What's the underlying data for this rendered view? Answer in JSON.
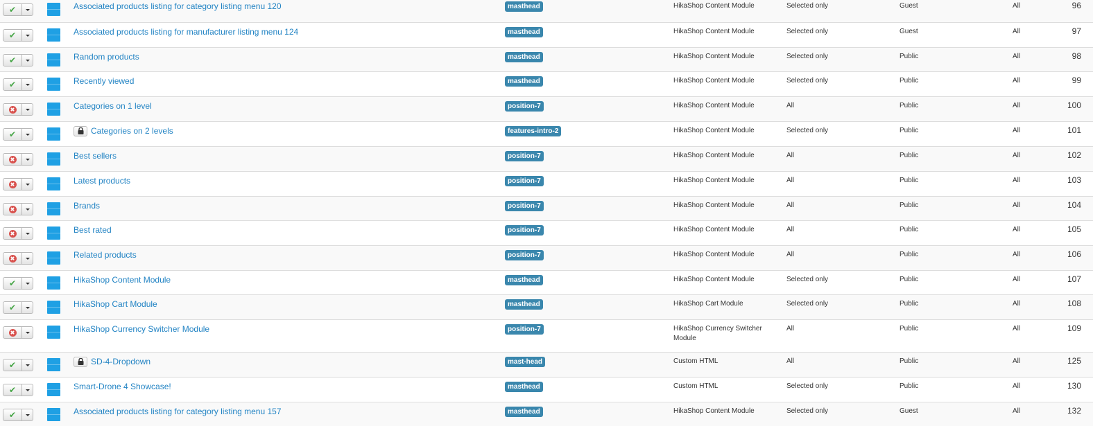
{
  "icons": {
    "published": "check-icon",
    "unpublished": "x-circle-icon",
    "locked": "lock-icon",
    "handle": "drag-handle-icon",
    "caret": "caret-down-icon"
  },
  "colors": {
    "link": "#2384c4",
    "badge": "#3a87ad",
    "handle": "#1fa0e4",
    "published": "#46a546",
    "unpublished": "#d9534f"
  },
  "rows": [
    {
      "status": "published",
      "locked": false,
      "title": "Associated products listing for category listing menu 120",
      "position": "masthead",
      "type": "HikaShop Content Module",
      "pages": "Selected only",
      "access": "Guest",
      "language": "All",
      "id": "96"
    },
    {
      "status": "published",
      "locked": false,
      "title": "Associated products listing for manufacturer listing menu 124",
      "position": "masthead",
      "type": "HikaShop Content Module",
      "pages": "Selected only",
      "access": "Guest",
      "language": "All",
      "id": "97"
    },
    {
      "status": "published",
      "locked": false,
      "title": "Random products",
      "position": "masthead",
      "type": "HikaShop Content Module",
      "pages": "Selected only",
      "access": "Public",
      "language": "All",
      "id": "98"
    },
    {
      "status": "published",
      "locked": false,
      "title": "Recently viewed",
      "position": "masthead",
      "type": "HikaShop Content Module",
      "pages": "Selected only",
      "access": "Public",
      "language": "All",
      "id": "99"
    },
    {
      "status": "unpublished",
      "locked": false,
      "title": "Categories on 1 level",
      "position": "position-7",
      "type": "HikaShop Content Module",
      "pages": "All",
      "access": "Public",
      "language": "All",
      "id": "100"
    },
    {
      "status": "published",
      "locked": true,
      "title": "Categories on 2 levels",
      "position": "features-intro-2",
      "type": "HikaShop Content Module",
      "pages": "Selected only",
      "access": "Public",
      "language": "All",
      "id": "101"
    },
    {
      "status": "unpublished",
      "locked": false,
      "title": "Best sellers",
      "position": "position-7",
      "type": "HikaShop Content Module",
      "pages": "All",
      "access": "Public",
      "language": "All",
      "id": "102"
    },
    {
      "status": "unpublished",
      "locked": false,
      "title": "Latest products",
      "position": "position-7",
      "type": "HikaShop Content Module",
      "pages": "All",
      "access": "Public",
      "language": "All",
      "id": "103"
    },
    {
      "status": "unpublished",
      "locked": false,
      "title": "Brands",
      "position": "position-7",
      "type": "HikaShop Content Module",
      "pages": "All",
      "access": "Public",
      "language": "All",
      "id": "104"
    },
    {
      "status": "unpublished",
      "locked": false,
      "title": "Best rated",
      "position": "position-7",
      "type": "HikaShop Content Module",
      "pages": "All",
      "access": "Public",
      "language": "All",
      "id": "105"
    },
    {
      "status": "unpublished",
      "locked": false,
      "title": "Related products",
      "position": "position-7",
      "type": "HikaShop Content Module",
      "pages": "All",
      "access": "Public",
      "language": "All",
      "id": "106"
    },
    {
      "status": "published",
      "locked": false,
      "title": "HikaShop Content Module",
      "position": "masthead",
      "type": "HikaShop Content Module",
      "pages": "Selected only",
      "access": "Public",
      "language": "All",
      "id": "107"
    },
    {
      "status": "published",
      "locked": false,
      "title": "HikaShop Cart Module",
      "position": "masthead",
      "type": "HikaShop Cart Module",
      "pages": "Selected only",
      "access": "Public",
      "language": "All",
      "id": "108"
    },
    {
      "status": "unpublished",
      "locked": false,
      "title": "HikaShop Currency Switcher Module",
      "position": "position-7",
      "type": "HikaShop Currency Switcher Module",
      "pages": "All",
      "access": "Public",
      "language": "All",
      "id": "109"
    },
    {
      "status": "published",
      "locked": true,
      "title": "SD-4-Dropdown",
      "position": "mast-head",
      "type": "Custom HTML",
      "pages": "All",
      "access": "Public",
      "language": "All",
      "id": "125"
    },
    {
      "status": "published",
      "locked": false,
      "title": "Smart-Drone 4 Showcase!",
      "position": "masthead",
      "type": "Custom HTML",
      "pages": "Selected only",
      "access": "Public",
      "language": "All",
      "id": "130"
    },
    {
      "status": "published",
      "locked": false,
      "title": "Associated products listing for category listing menu 157",
      "position": "masthead",
      "type": "HikaShop Content Module",
      "pages": "Selected only",
      "access": "Guest",
      "language": "All",
      "id": "132"
    }
  ]
}
